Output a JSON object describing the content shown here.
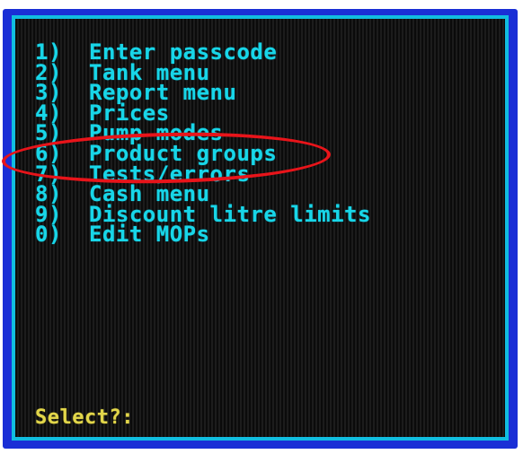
{
  "menu": {
    "items": [
      {
        "num": "1)",
        "label": "Enter passcode"
      },
      {
        "num": "2)",
        "label": "Tank menu"
      },
      {
        "num": "3)",
        "label": "Report menu"
      },
      {
        "num": "4)",
        "label": "Prices"
      },
      {
        "num": "5)",
        "label": "Pump modes"
      },
      {
        "num": "6)",
        "label": "Product groups"
      },
      {
        "num": "7)",
        "label": "Tests/errors"
      },
      {
        "num": "8)",
        "label": "Cash menu"
      },
      {
        "num": "9)",
        "label": "Discount litre limits"
      },
      {
        "num": "0)",
        "label": "Edit MOPs"
      }
    ]
  },
  "prompt": {
    "label": "Select?:"
  },
  "colors": {
    "bezel": "#1a2fd6",
    "screen_border": "#11bde0",
    "menu_text": "#18d6e8",
    "prompt_text": "#e2d64a",
    "highlight_ring": "#e8141a"
  }
}
